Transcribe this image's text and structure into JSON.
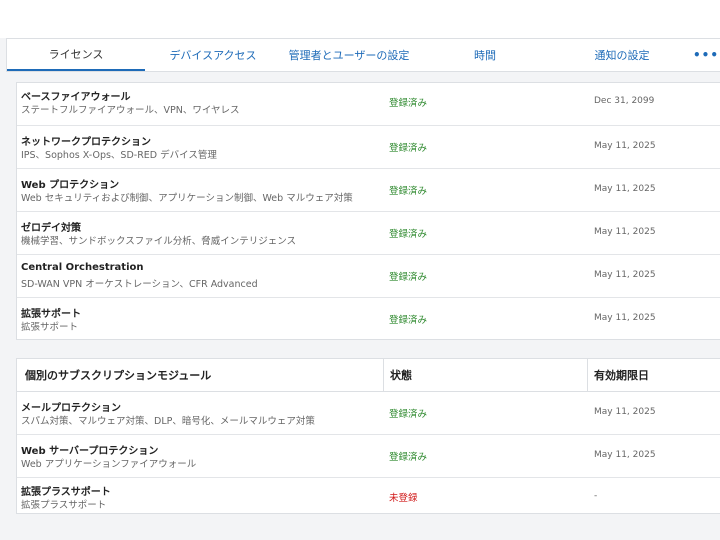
{
  "tabs": [
    {
      "label": "ライセンス",
      "active": true
    },
    {
      "label": "デバイスアクセス"
    },
    {
      "label": "管理者とユーザーの設定"
    },
    {
      "label": "時間"
    },
    {
      "label": "通知の設定"
    }
  ],
  "more_icon": "ellipsis-icon",
  "more_glyph": "•••",
  "base_modules": [
    {
      "name": "ベースファイアウォール",
      "desc": "ステートフルファイアウォール、VPN、ワイヤレス",
      "status": "登録済み",
      "date": "Dec 31, 2099"
    },
    {
      "name": "ネットワークプロテクション",
      "desc": "IPS、Sophos X-Ops、SD-RED デバイス管理",
      "status": "登録済み",
      "date": "May 11, 2025"
    },
    {
      "name": "Web プロテクション",
      "desc": "Web セキュリティおよび制御、アプリケーション制御、Web マルウェア対策",
      "status": "登録済み",
      "date": "May 11, 2025"
    },
    {
      "name": "ゼロデイ対策",
      "desc": "機械学習、サンドボックスファイル分析、脅威インテリジェンス",
      "status": "登録済み",
      "date": "May 11, 2025"
    },
    {
      "name": "Central Orchestration",
      "desc": "SD-WAN VPN オーケストレーション、CFR Advanced",
      "status": "登録済み",
      "date": "May 11, 2025"
    },
    {
      "name": "拡張サポート",
      "desc": "拡張サポート",
      "status": "登録済み",
      "date": "May 11, 2025"
    }
  ],
  "individual": {
    "headers": {
      "module": "個別のサブスクリプションモジュール",
      "status": "状態",
      "expiry": "有効期限日"
    },
    "rows": [
      {
        "name": "メールプロテクション",
        "desc": "スパム対策、マルウェア対策、DLP、暗号化、メールマルウェア対策",
        "status": "登録済み",
        "date": "May 11, 2025"
      },
      {
        "name": "Web サーバープロテクション",
        "desc": "Web アプリケーションファイアウォール",
        "status": "登録済み",
        "date": "May 11, 2025"
      },
      {
        "name": "拡張プラスサポート",
        "desc": "拡張プラスサポート",
        "status": "未登録",
        "date": "-",
        "unregistered": true
      }
    ]
  },
  "colors": {
    "registered": "#2f8a2f",
    "unregistered": "#d11a1a",
    "accent": "#1e6bb8"
  }
}
